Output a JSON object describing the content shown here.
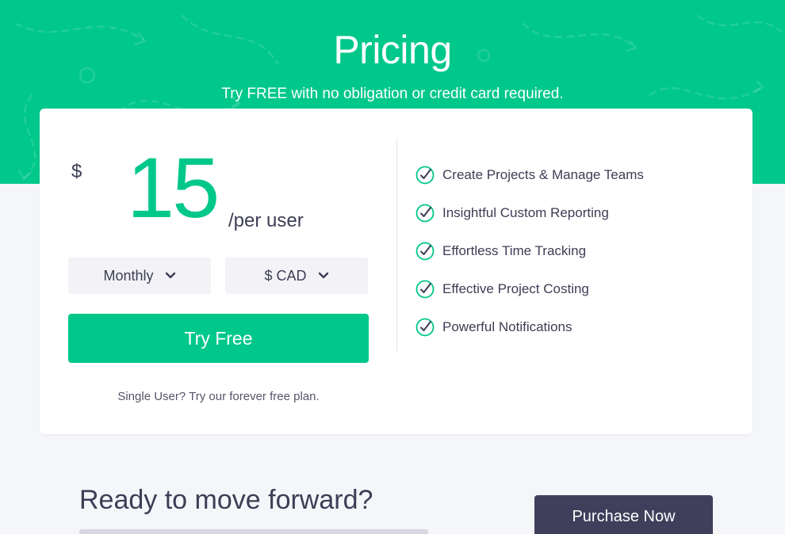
{
  "hero": {
    "title": "Pricing",
    "subtitle": "Try FREE with no obligation or credit card required.",
    "background_color": "#00c88a"
  },
  "pricing_card": {
    "currency_symbol": "$",
    "price": "15",
    "price_unit": "/per user",
    "billing_select": {
      "value": "Monthly",
      "icon": "chevron-down-icon"
    },
    "currency_select": {
      "value": "$ CAD",
      "icon": "chevron-down-icon"
    },
    "try_button_label": "Try Free",
    "free_plan_text": "Single User? Try our forever free plan.",
    "features": [
      {
        "label": "Create Projects & Manage Teams",
        "icon": "check-circle-icon"
      },
      {
        "label": "Insightful Custom Reporting",
        "icon": "check-circle-icon"
      },
      {
        "label": "Effortless Time Tracking",
        "icon": "check-circle-icon"
      },
      {
        "label": "Effective Project Costing",
        "icon": "check-circle-icon"
      },
      {
        "label": "Powerful Notifications",
        "icon": "check-circle-icon"
      }
    ]
  },
  "cta": {
    "title": "Ready to move forward?",
    "purchase_button_label": "Purchase Now"
  },
  "colors": {
    "accent": "#00c88a",
    "dark_button": "#3f3f5c",
    "text": "#3d3d55",
    "page_background": "#f5f6fa"
  }
}
